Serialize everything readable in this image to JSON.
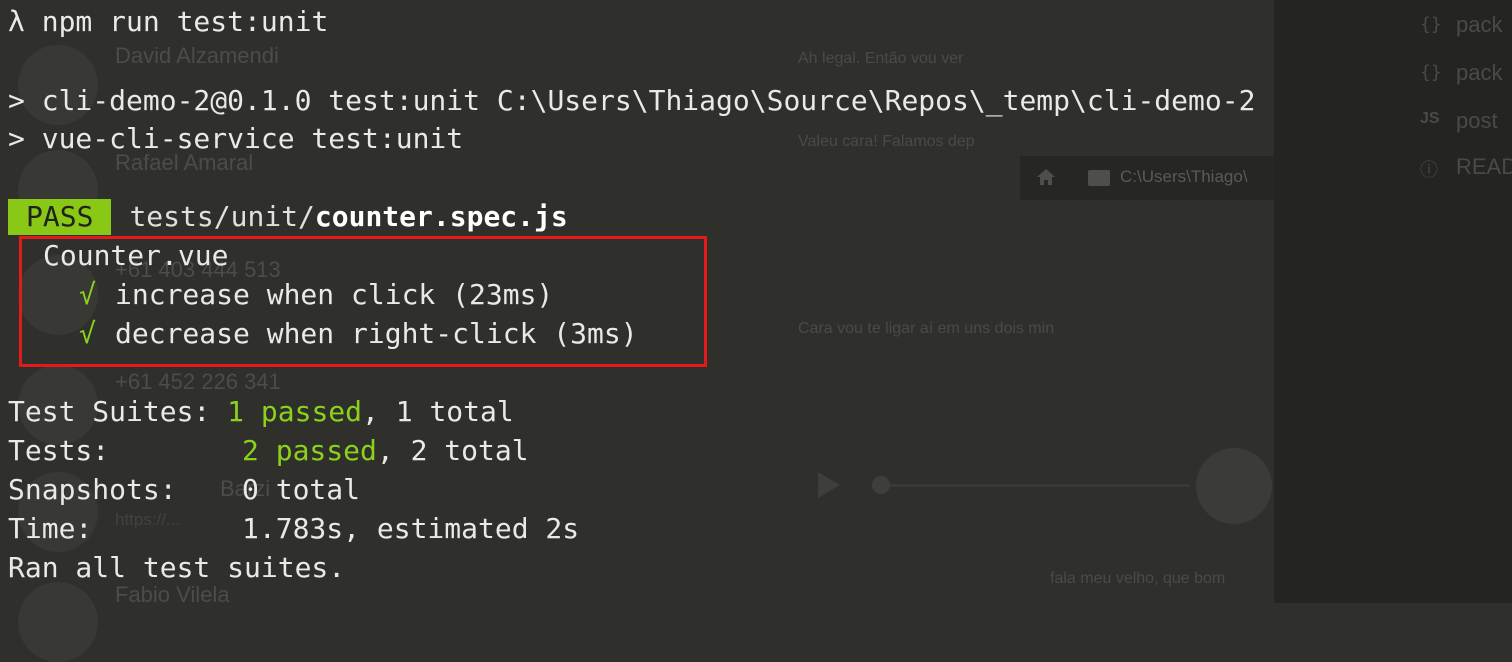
{
  "terminal": {
    "prompt_symbol": "λ",
    "command": "npm run test:unit",
    "script_lines": [
      "> cli-demo-2@0.1.0 test:unit C:\\Users\\Thiago\\Source\\Repos\\_temp\\cli-demo-2",
      "> vue-cli-service test:unit"
    ],
    "result": {
      "badge": "PASS",
      "file_dir": "tests/unit/",
      "file_name": "counter.spec.js"
    },
    "suite": {
      "name": "Counter.vue",
      "tests": [
        {
          "mark": "√",
          "label": "increase when click (23ms)"
        },
        {
          "mark": "√",
          "label": "decrease when right-click (3ms)"
        }
      ]
    },
    "summary": {
      "suites_label": "Test Suites:",
      "suites_passed": "1 passed",
      "suites_total": ", 1 total",
      "tests_label": "Tests:",
      "tests_passed": "2 passed",
      "tests_total": ", 2 total",
      "snapshots_label": "Snapshots:",
      "snapshots_value": "0 total",
      "time_label": "Time:",
      "time_value": "1.783s, estimated 2s",
      "footer": "Ran all test suites."
    },
    "colors": {
      "background": "#2f2f2c",
      "text": "#e9e9e6",
      "pass_badge": "#8ac816",
      "success_green": "#8bd21a",
      "highlight_box": "#e21a1a"
    }
  },
  "background": {
    "contacts": [
      {
        "name": "David Alzamendi",
        "status": "",
        "time": ""
      },
      {
        "name": "Rafael Amaral",
        "status": "",
        "time": ""
      },
      {
        "name": "+61 403 444 513",
        "status": "",
        "time": ""
      },
      {
        "name": "+61 452 226 341",
        "status": "",
        "time": ""
      },
      {
        "name": "Barzi",
        "status": "https://...",
        "time": ""
      },
      {
        "name": "Fabio Vilela",
        "status": "",
        "time": ""
      }
    ],
    "chat_messages": [
      "Ah legal. Então vou ver",
      "Valeu cara! Falamos dep",
      "Cara vou te ligar aí em uns dois min",
      "fala meu velho, que bom"
    ],
    "explorer_path": "C:\\Users\\Thiago\\",
    "sidebar_files": [
      {
        "icon": "curly-braces-icon",
        "glyph": "{}",
        "name": "pack"
      },
      {
        "icon": "curly-braces-icon",
        "glyph": "{}",
        "name": "pack"
      },
      {
        "icon": "js-file-icon",
        "glyph": "JS",
        "name": "post"
      },
      {
        "icon": "info-icon",
        "glyph": "ⓘ",
        "name": "READ"
      }
    ]
  }
}
